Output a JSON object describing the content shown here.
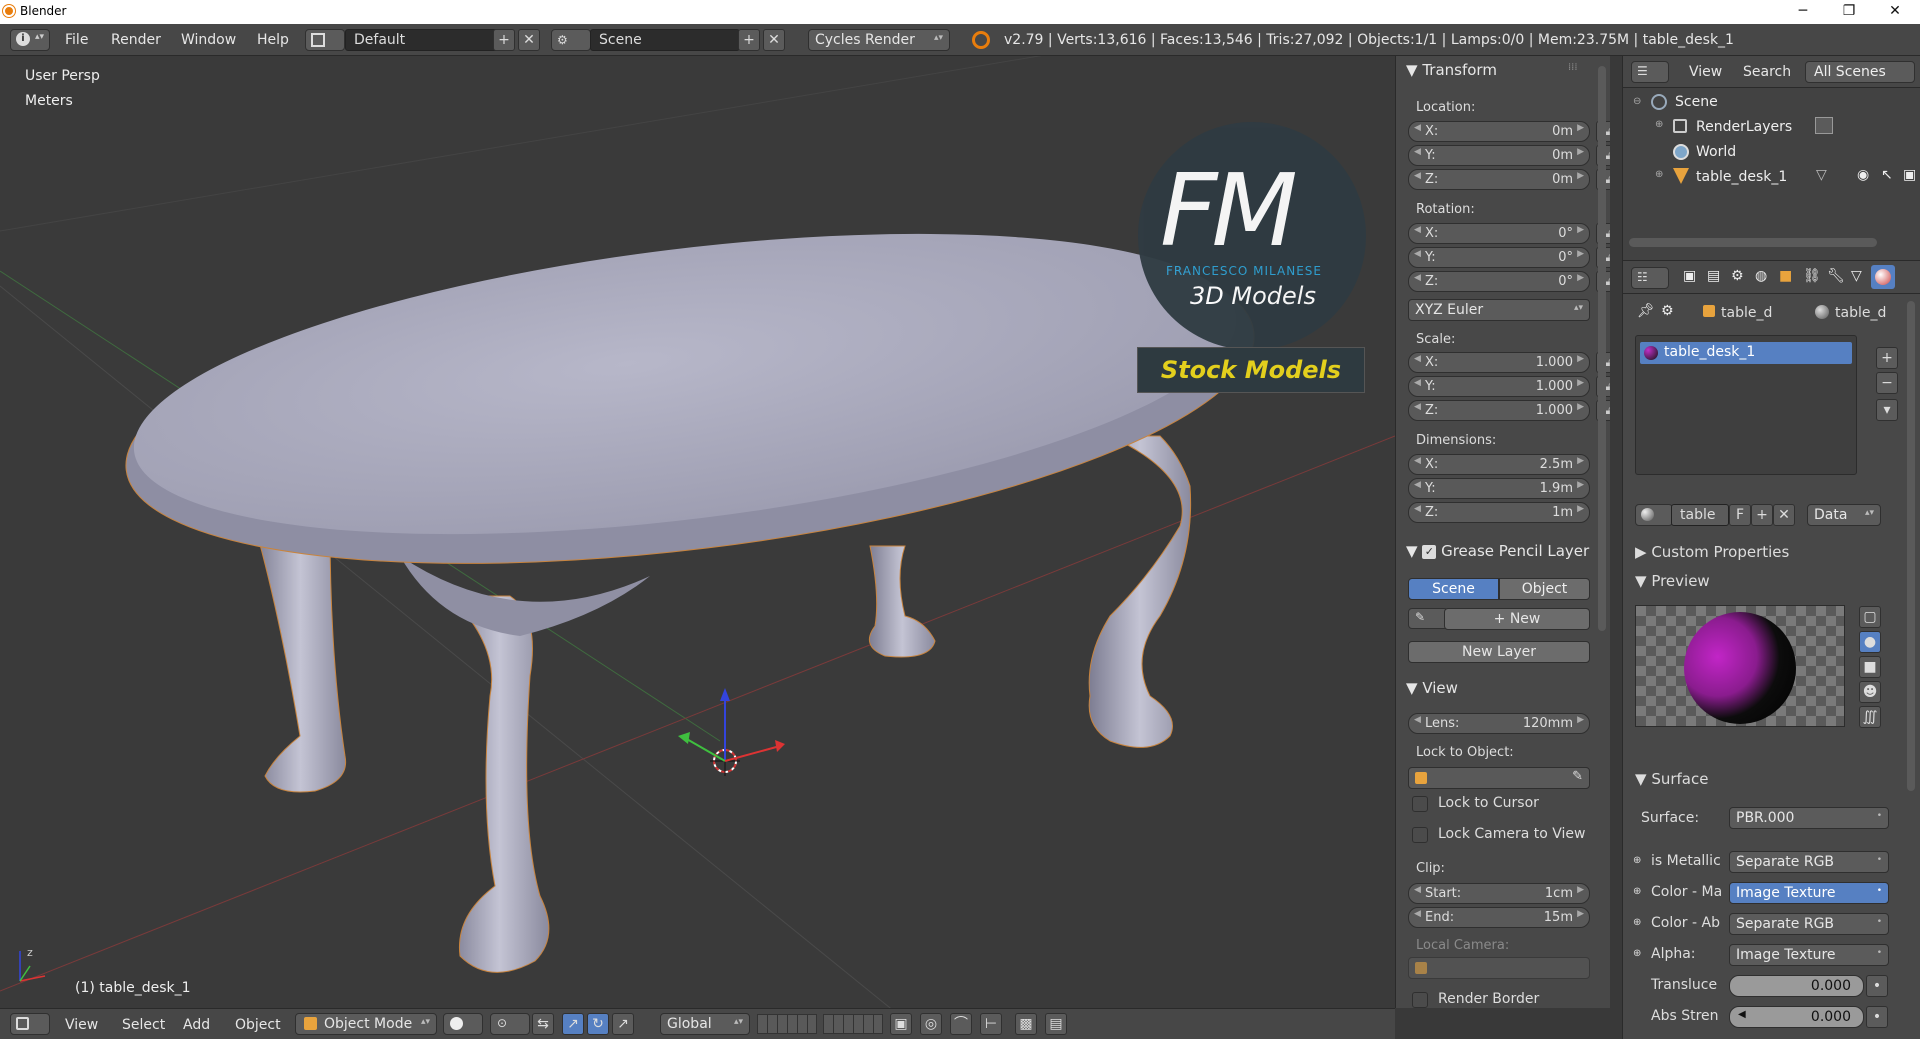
{
  "window": {
    "title": "Blender",
    "min": "─",
    "max": "❐",
    "close": "✕"
  },
  "infobar": {
    "menus": [
      "File",
      "Render",
      "Window",
      "Help"
    ],
    "screen_layout": "Default",
    "scene": "Scene",
    "engine": "Cycles Render",
    "stats": "v2.79 | Verts:13,616 | Faces:13,546 | Tris:27,092 | Objects:1/1 | Lamps:0/0 | Mem:23.75M | table_desk_1"
  },
  "viewport": {
    "view_name": "User Persp",
    "units": "Meters",
    "object_label": "(1) table_desk_1",
    "watermark": {
      "initials": "FM",
      "name": "FRANCESCO MILANESE",
      "sub": "3D Models",
      "banner": "Stock Models"
    }
  },
  "bottombar": {
    "menus": [
      "View",
      "Select",
      "Add",
      "Object"
    ],
    "mode": "Object Mode",
    "orientation": "Global"
  },
  "npanel": {
    "transform": {
      "title": "Transform",
      "location_label": "Location:",
      "location": [
        {
          "k": "X:",
          "v": "0m"
        },
        {
          "k": "Y:",
          "v": "0m"
        },
        {
          "k": "Z:",
          "v": "0m"
        }
      ],
      "rotation_label": "Rotation:",
      "rotation": [
        {
          "k": "X:",
          "v": "0°"
        },
        {
          "k": "Y:",
          "v": "0°"
        },
        {
          "k": "Z:",
          "v": "0°"
        }
      ],
      "rotation_mode": "XYZ Euler",
      "scale_label": "Scale:",
      "scale": [
        {
          "k": "X:",
          "v": "1.000"
        },
        {
          "k": "Y:",
          "v": "1.000"
        },
        {
          "k": "Z:",
          "v": "1.000"
        }
      ],
      "dimensions_label": "Dimensions:",
      "dimensions": [
        {
          "k": "X:",
          "v": "2.5m"
        },
        {
          "k": "Y:",
          "v": "1.9m"
        },
        {
          "k": "Z:",
          "v": "1m"
        }
      ]
    },
    "grease": {
      "title": "Grease Pencil Layer",
      "tab_scene": "Scene",
      "tab_object": "Object",
      "new": "New",
      "new_layer": "New Layer"
    },
    "view": {
      "title": "View",
      "lens_label": "Lens:",
      "lens": "120mm",
      "lock_to_object": "Lock to Object:",
      "lock_cursor": "Lock to Cursor",
      "lock_camera": "Lock Camera to View",
      "clip_label": "Clip:",
      "clip_start_label": "Start:",
      "clip_start": "1cm",
      "clip_end_label": "End:",
      "clip_end": "15m",
      "local_camera": "Local Camera:",
      "render_border": "Render Border"
    }
  },
  "outliner": {
    "menus": [
      "View",
      "Search"
    ],
    "filter": "All Scenes",
    "items": [
      "Scene",
      "RenderLayers",
      "World",
      "table_desk_1"
    ]
  },
  "properties": {
    "breadcrumb": [
      "table_d",
      "table_d"
    ],
    "material_slot": "table_desk_1",
    "material_name": "table",
    "fake_user": "F",
    "link": "Data",
    "custom_props": "Custom Properties",
    "preview": "Preview",
    "surface_title": "Surface",
    "surface_label": "Surface:",
    "surface_value": "PBR.000",
    "inputs": [
      {
        "label": "is Metallic",
        "value": "Separate RGB",
        "active": false
      },
      {
        "label": "Color - Ma",
        "value": "Image Texture",
        "active": true
      },
      {
        "label": "Color - Ab",
        "value": "Separate RGB",
        "active": false
      },
      {
        "label": "Alpha:",
        "value": "Image Texture",
        "active": false
      }
    ],
    "translucency_label": "Transluce",
    "translucency": "0.000",
    "abs_strength_label": "Abs Stren",
    "abs_strength": "0.000"
  }
}
